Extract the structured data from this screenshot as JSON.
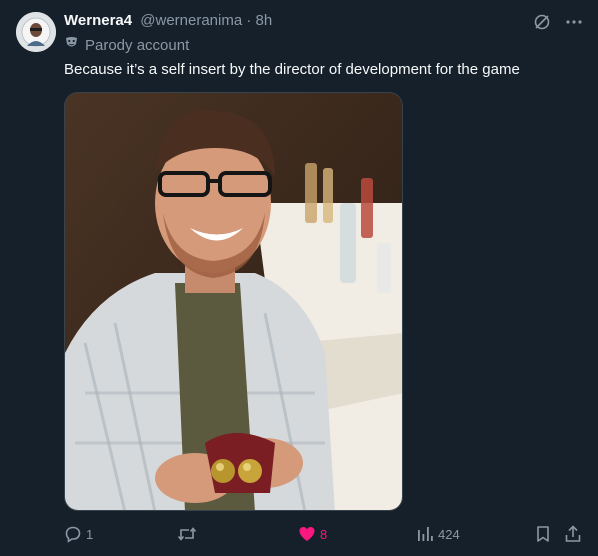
{
  "post": {
    "display_name": "Wernera4",
    "handle": "@werneranima",
    "separator": "·",
    "time": "8h",
    "label": "Parody account",
    "text": "Because it’s a self insert by the director of development for the game"
  },
  "actions": {
    "replies": "1",
    "reposts": "",
    "likes": "8",
    "views": "424"
  },
  "colors": {
    "background": "#15202b",
    "secondary_text": "#8b98a5",
    "like": "#f91880",
    "border": "#38444d"
  },
  "icons": {
    "grok": "slash-circle-icon",
    "more": "more-dots-icon",
    "parody": "mask-icon",
    "reply": "reply-icon",
    "repost": "repost-icon",
    "like": "heart-icon",
    "views": "bar-chart-icon",
    "bookmark": "bookmark-icon",
    "share": "share-icon"
  }
}
